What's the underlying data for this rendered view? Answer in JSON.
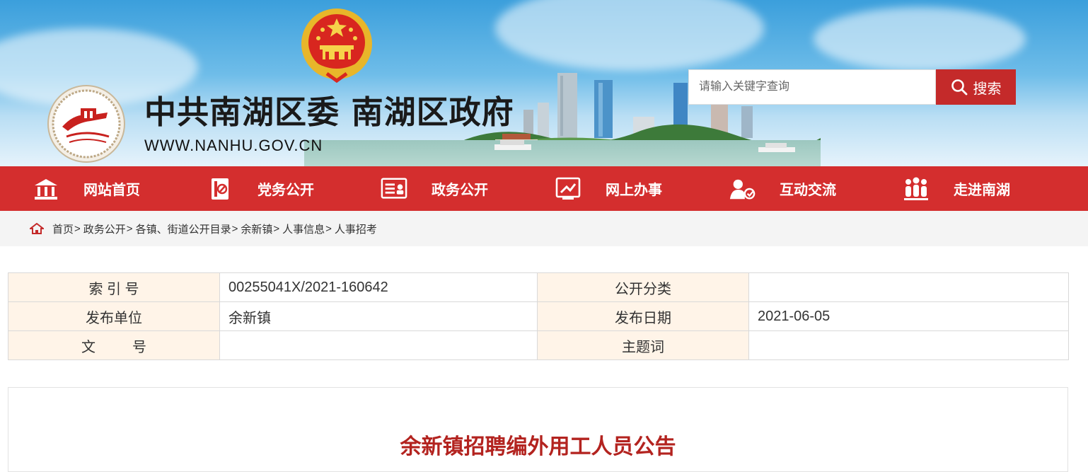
{
  "header": {
    "site_title": "中共南湖区委 南湖区政府",
    "site_domain": "WWW.NANHU.GOV.CN",
    "search_placeholder": "请输入关键字查询",
    "search_button": "搜索"
  },
  "nav": {
    "items": [
      {
        "label": "网站首页",
        "icon": "home-building-icon"
      },
      {
        "label": "党务公开",
        "icon": "party-flag-icon"
      },
      {
        "label": "政务公开",
        "icon": "government-card-icon"
      },
      {
        "label": "网上办事",
        "icon": "online-service-icon"
      },
      {
        "label": "互动交流",
        "icon": "interaction-user-icon"
      },
      {
        "label": "走进南湖",
        "icon": "people-group-icon"
      }
    ]
  },
  "breadcrumb": {
    "items": [
      "首页",
      "政务公开",
      "各镇、街道公开目录",
      "余新镇",
      "人事信息",
      "人事招考"
    ],
    "separator": ">"
  },
  "meta": {
    "index_label": "索 引 号",
    "index_value": "00255041X/2021-160642",
    "category_label": "公开分类",
    "category_value": "",
    "publisher_label": "发布单位",
    "publisher_value": "余新镇",
    "date_label": "发布日期",
    "date_value": "2021-06-05",
    "docno_label_a": "文",
    "docno_label_b": "号",
    "docno_value": "",
    "keywords_label": "主题词",
    "keywords_value": ""
  },
  "article": {
    "title": "余新镇招聘编外用工人员公告"
  },
  "colors": {
    "nav_red": "#d42e2e",
    "search_red": "#c42a2a",
    "title_red": "#b3231f",
    "meta_key_bg": "#fff4e8"
  }
}
